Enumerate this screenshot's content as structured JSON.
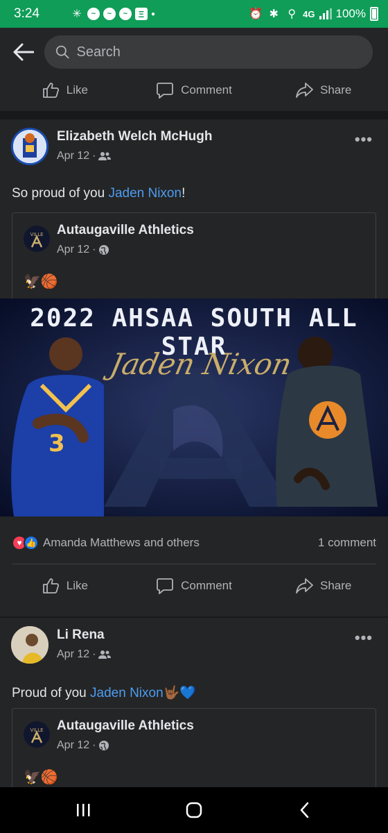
{
  "status_bar": {
    "time": "3:24",
    "network": "4G",
    "battery": "100%"
  },
  "header": {
    "search_placeholder": "Search"
  },
  "actions": {
    "like": "Like",
    "comment": "Comment",
    "share": "Share"
  },
  "posts": [
    {
      "author": "Elizabeth Welch McHugh",
      "date": "Apr 12",
      "privacy_icon": "friends-icon",
      "text_prefix": "So proud of you ",
      "mention": "Jaden Nixon",
      "text_suffix": "!",
      "shared": {
        "page": "Autaugaville Athletics",
        "date": "Apr 12",
        "privacy_icon": "globe-icon",
        "emoji": "🦅🏀",
        "banner_title": "2022 AHSAA SOUTH ALL STAR",
        "banner_name": "Jaden Nixon"
      },
      "reactions_text": "Amanda Matthews and others",
      "comments": "1 comment"
    },
    {
      "author": "Li Rena",
      "date": "Apr 12",
      "privacy_icon": "friends-icon",
      "text_prefix": "Proud of you ",
      "mention": "Jaden Nixon",
      "text_suffix": "🤟🏾💙",
      "shared": {
        "page": "Autaugaville Athletics",
        "date": "Apr 12",
        "privacy_icon": "globe-icon",
        "emoji": "🦅🏀"
      }
    }
  ],
  "colors": {
    "status_bar": "#0f9d58",
    "background": "#18191a",
    "card": "#242526",
    "link": "#4d9cf0",
    "banner_gold": "#c9ad6a"
  }
}
